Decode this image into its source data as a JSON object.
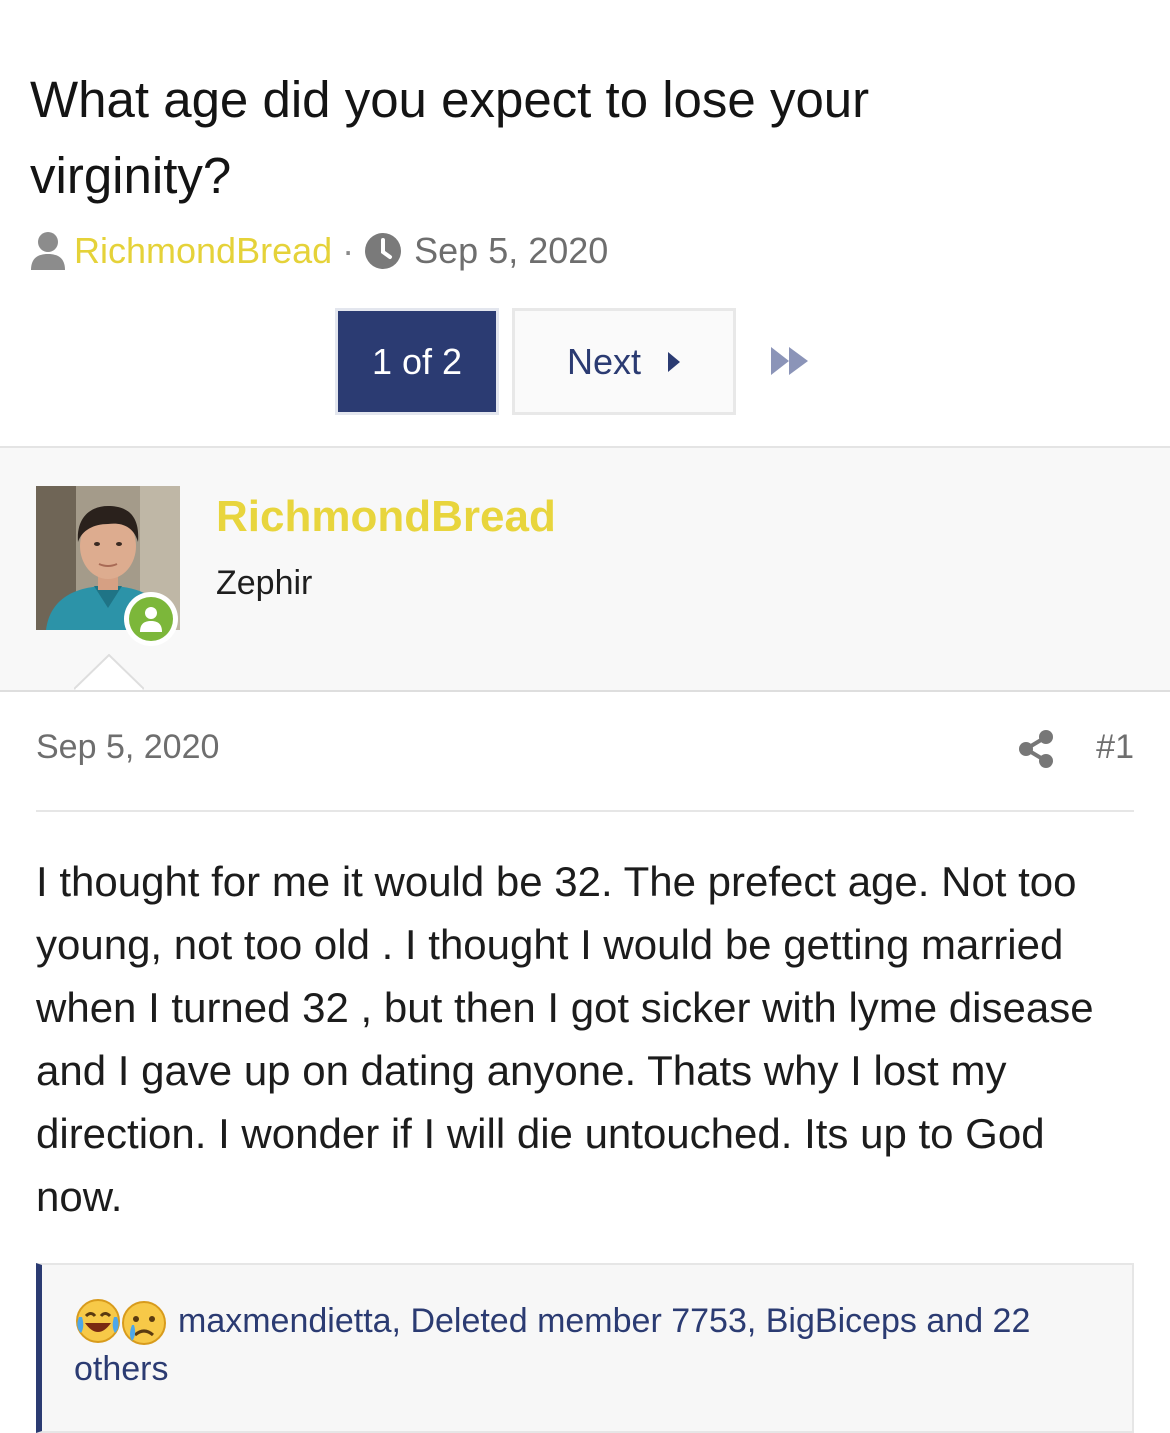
{
  "thread": {
    "title": "What age did you expect to lose your virginity?",
    "author": "RichmondBread",
    "separator": "·",
    "date": "Sep 5, 2020"
  },
  "pagination": {
    "current": "1 of 2",
    "next_label": "Next"
  },
  "post": {
    "username": "RichmondBread",
    "user_title": "Zephir",
    "date": "Sep 5, 2020",
    "number": "#1",
    "body": "I thought for me it would be 32. The prefect age. Not too young, not too old . I thought I would be getting married when I turned 32 , but then I got sicker with lyme disease and I gave up on dating anyone. Thats why I lost my direction. I wonder if I will die untouched. Its up to God now.",
    "reactions": {
      "icons": [
        "laughing-crying-emoji",
        "sad-emoji"
      ],
      "text": "maxmendietta, Deleted member 7753, BigBiceps and 22 others"
    }
  },
  "colors": {
    "accent_navy": "#2b3b72",
    "username_yellow": "#e5d239",
    "online_green": "#7cb73a"
  }
}
